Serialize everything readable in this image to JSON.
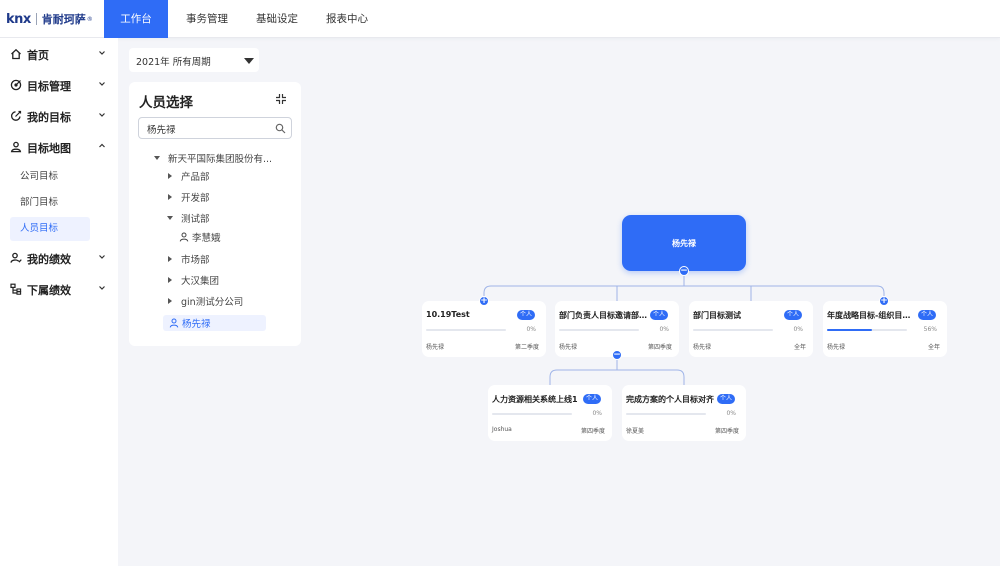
{
  "brand": {
    "mark": "knx",
    "name": "肯耐珂萨",
    "reg": "®"
  },
  "topnav": [
    "工作台",
    "事务管理",
    "基础设定",
    "报表中心"
  ],
  "sidebar": {
    "menu": [
      {
        "label": "首页",
        "icon": "home-icon"
      },
      {
        "label": "目标管理",
        "icon": "target-icon"
      },
      {
        "label": "我的目标",
        "icon": "edit-target-icon"
      },
      {
        "label": "目标地图",
        "icon": "user-map-icon"
      }
    ],
    "submenu": [
      "公司目标",
      "部门目标",
      "人员目标"
    ],
    "menu2": [
      {
        "label": "我的绩效",
        "icon": "user-performance-icon"
      },
      {
        "label": "下属绩效",
        "icon": "org-performance-icon"
      }
    ]
  },
  "period": {
    "value": "2021年 所有周期"
  },
  "panel": {
    "title": "人员选择",
    "search_value": "杨先禄",
    "tree": {
      "root": "新天平国际集团股份有...",
      "dept1": "产品部",
      "dept2": "开发部",
      "dept3": "测试部",
      "person1": "李慧娥",
      "dept4": "市场部",
      "dept5": "大汉集团",
      "dept6": "gin测试分公司",
      "person2": "杨先禄"
    }
  },
  "chart": {
    "root": {
      "name": "杨先禄"
    },
    "goals": [
      {
        "title": "10.19Test",
        "badge": "个人",
        "progress": 0,
        "pct": "0%",
        "owner": "杨先禄",
        "period": "第二季度"
      },
      {
        "title": "部门负责人目标邀请部门...",
        "badge": "个人",
        "progress": 0,
        "pct": "0%",
        "owner": "杨先禄",
        "period": "第四季度"
      },
      {
        "title": "部门目标测试",
        "badge": "个人",
        "progress": 0,
        "pct": "0%",
        "owner": "杨先禄",
        "period": "全年"
      },
      {
        "title": "年度战略目标-组织目标关...",
        "badge": "个人",
        "progress": 0.56,
        "pct": "56%",
        "owner": "杨先禄",
        "period": "全年"
      },
      {
        "title": "人力资源相关系统上线1",
        "badge": "个人",
        "progress": 0,
        "pct": "0%",
        "owner": "Joshua",
        "period": "第四季度"
      },
      {
        "title": "完成方案的个人目标对齐",
        "badge": "个人",
        "progress": 0,
        "pct": "0%",
        "owner": "徐夏美",
        "period": "第四季度"
      }
    ]
  }
}
